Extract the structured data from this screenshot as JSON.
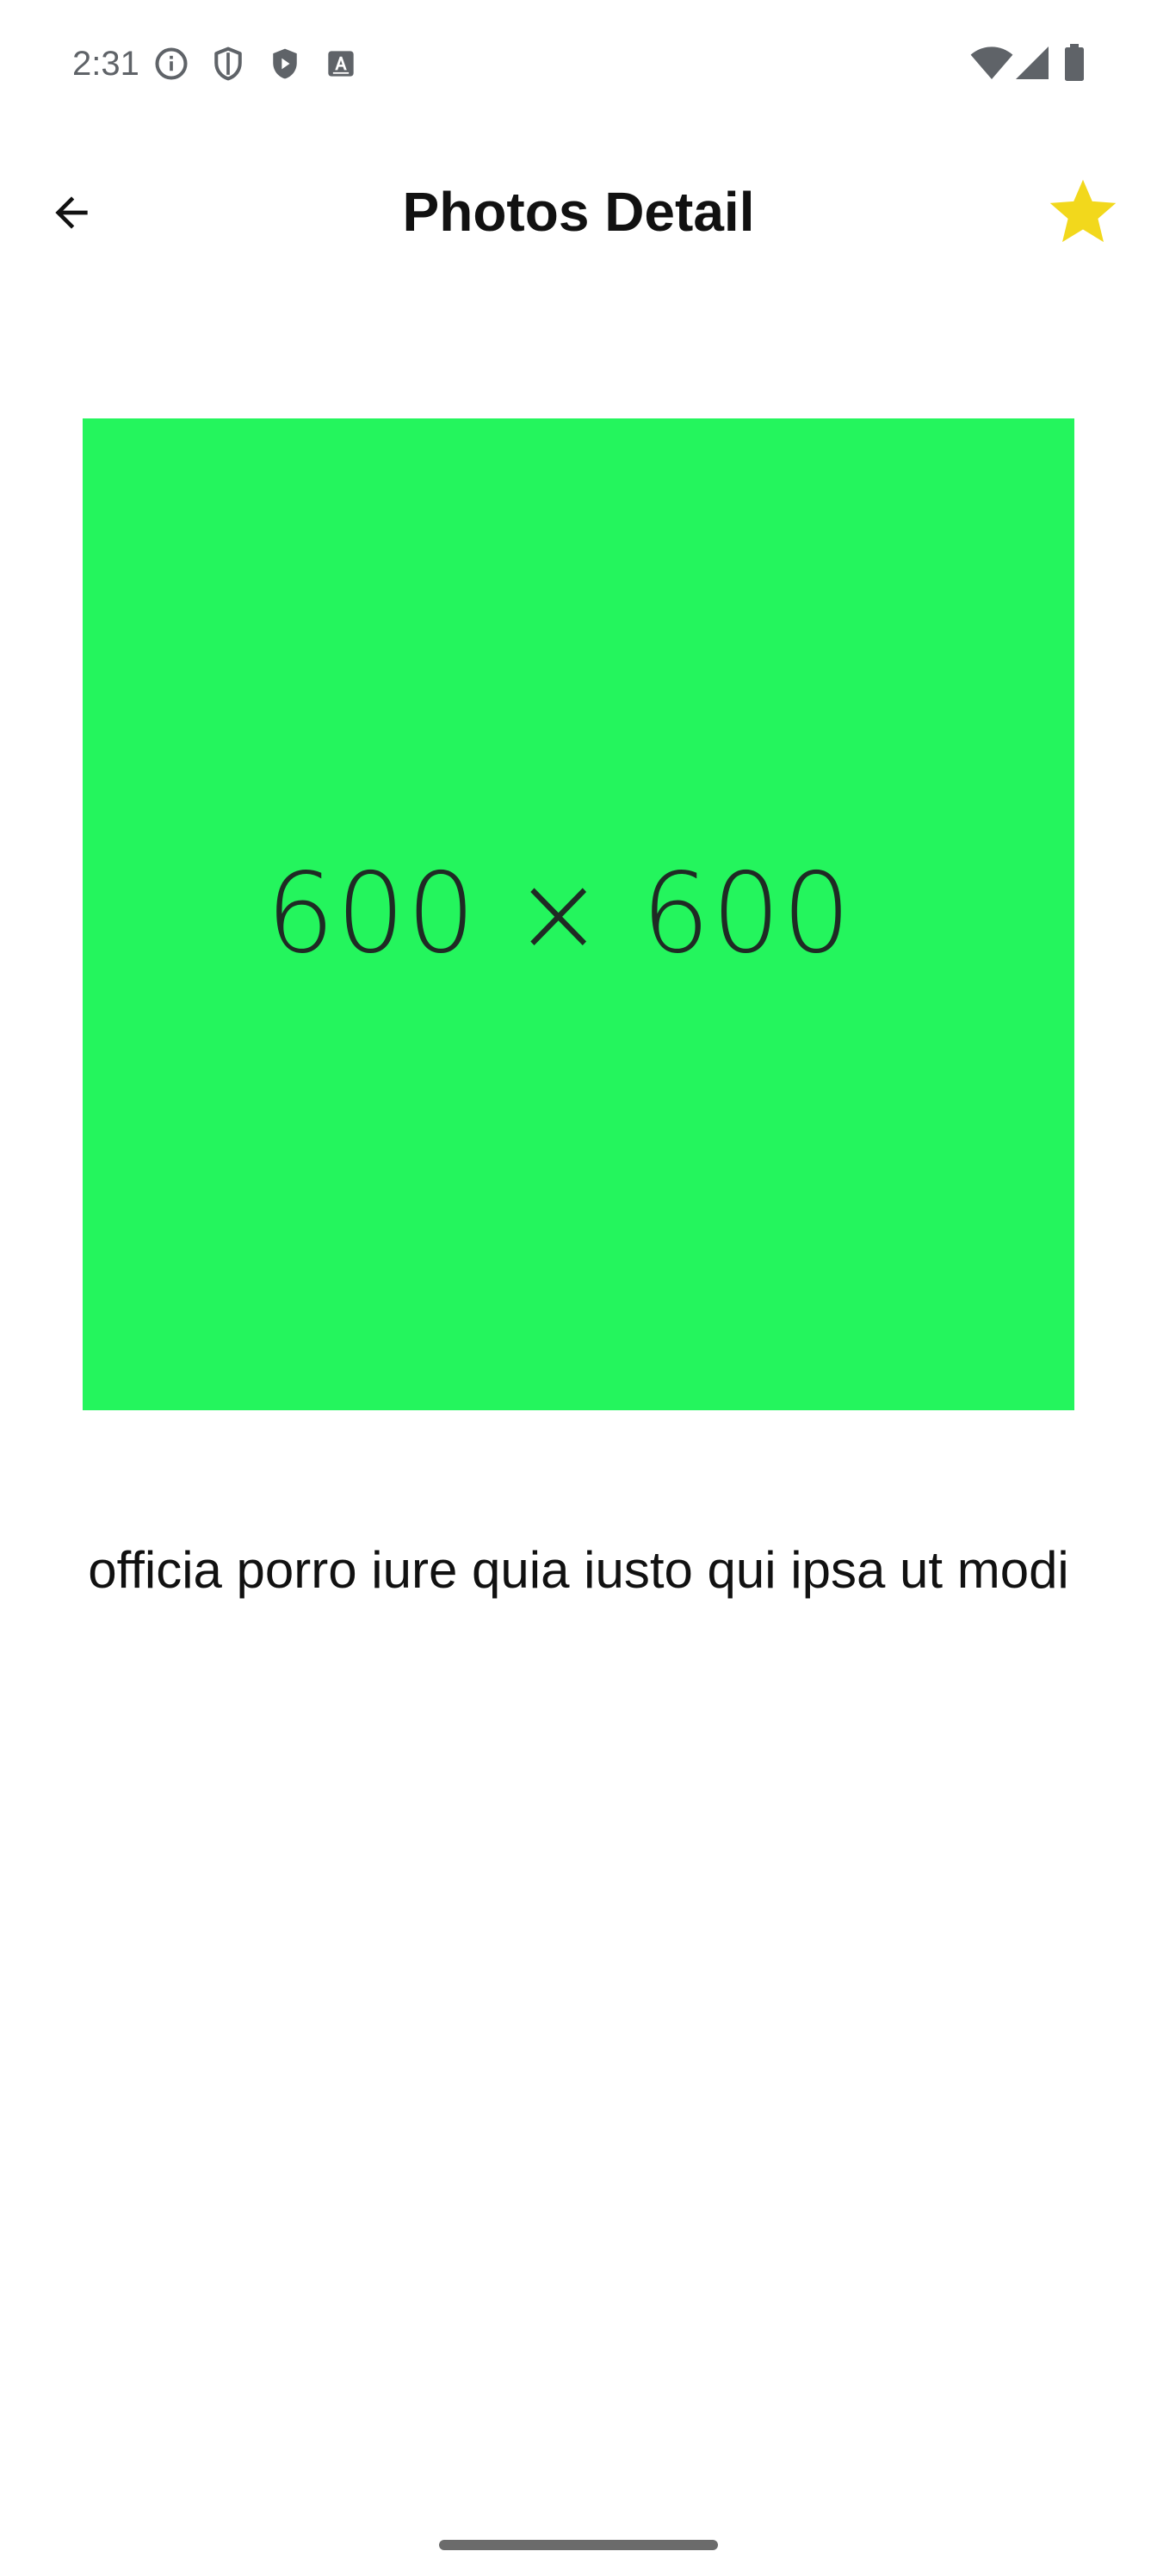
{
  "status_bar": {
    "time": "2:31",
    "left_icons": [
      "info-icon",
      "shield-icon",
      "play-protect-icon",
      "keyboard-a-icon"
    ],
    "right_icons": [
      "wifi-icon",
      "cellular-signal-icon",
      "battery-icon"
    ],
    "icon_color": "#5f6368"
  },
  "app_bar": {
    "title": "Photos Detail",
    "back_icon": "arrow-left-icon",
    "favorite_icon": "star-icon",
    "favorite_color": "#f2d81c"
  },
  "photo": {
    "label": "600 × 600",
    "background_color": "#24f55d"
  },
  "caption": {
    "text": "officia porro iure quia iusto qui ipsa ut modi"
  }
}
